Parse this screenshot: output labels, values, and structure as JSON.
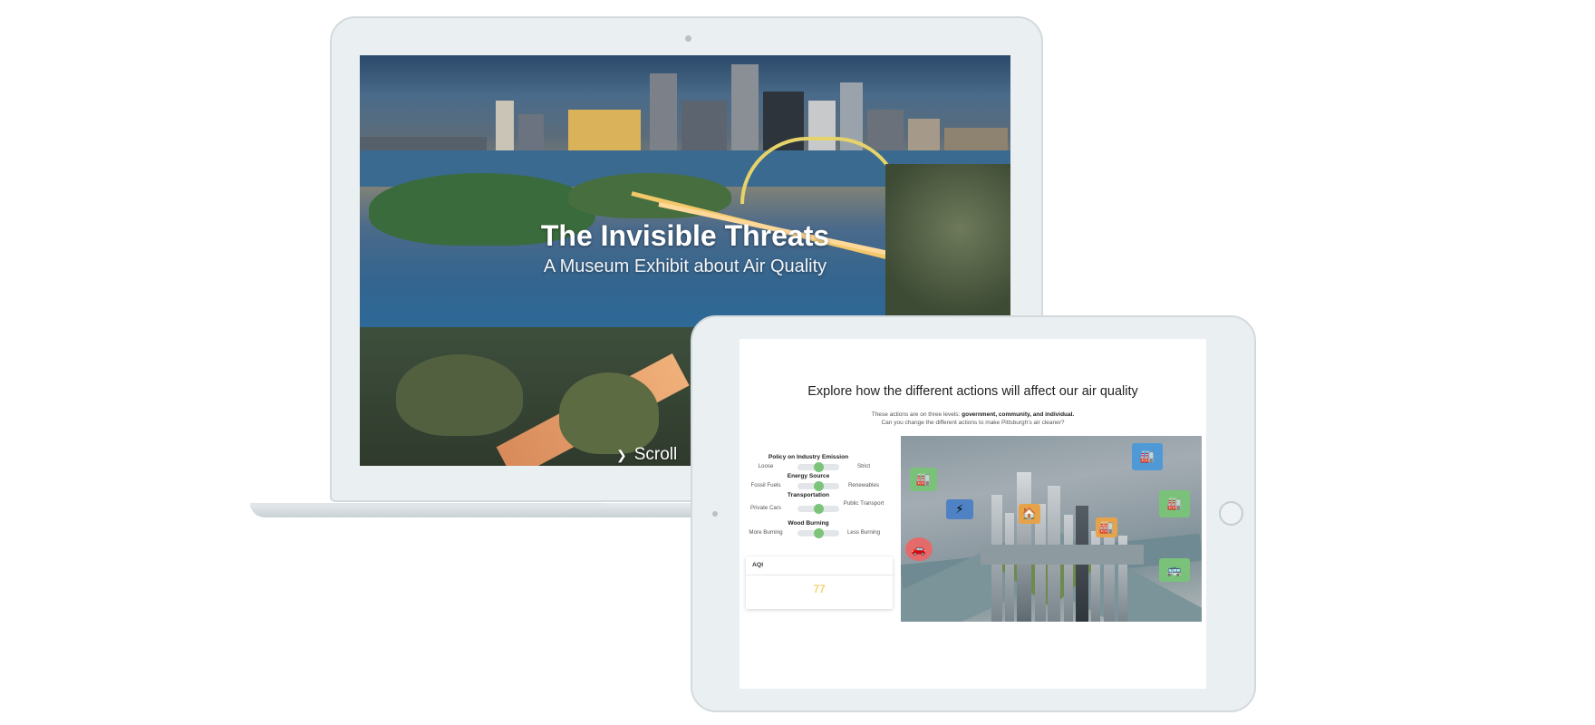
{
  "laptop": {
    "hero_title": "The Invisible Threats",
    "hero_subtitle": "A Museum Exhibit about Air Quality",
    "scroll_label": "Scroll"
  },
  "tablet": {
    "title": "Explore how the different actions will affect our air quality",
    "description_prefix": "These actions are on three levels: ",
    "description_levels": "government, community, and individual.",
    "description_line2": "Can you change the different actions to make Pittsburgh's air cleaner?",
    "controls": [
      {
        "label": "Policy on Industry Emission",
        "left": "Loose",
        "right": "Strict",
        "value": 0.5
      },
      {
        "label": "Energy Source",
        "left": "Fossil Fuels",
        "right": "Renewables",
        "value": 0.5
      },
      {
        "label": "Transportation",
        "left": "Private Cars",
        "right": "Public Transport",
        "value": 0.5
      },
      {
        "label": "Wood Burning",
        "left": "More Burning",
        "right": "Less Burning",
        "value": 0.5
      }
    ],
    "aqi_label": "AQI",
    "aqi_value": "77",
    "map_icons": [
      "factory-icon",
      "factory-icon",
      "factory-icon",
      "factory-icon",
      "power-plant-icon",
      "car-icon",
      "bus-icon",
      "house-icon"
    ]
  },
  "colors": {
    "slider_thumb": "#7cc47a",
    "aqi_value": "#f2c12e",
    "device_frame": "#eaeff1"
  }
}
